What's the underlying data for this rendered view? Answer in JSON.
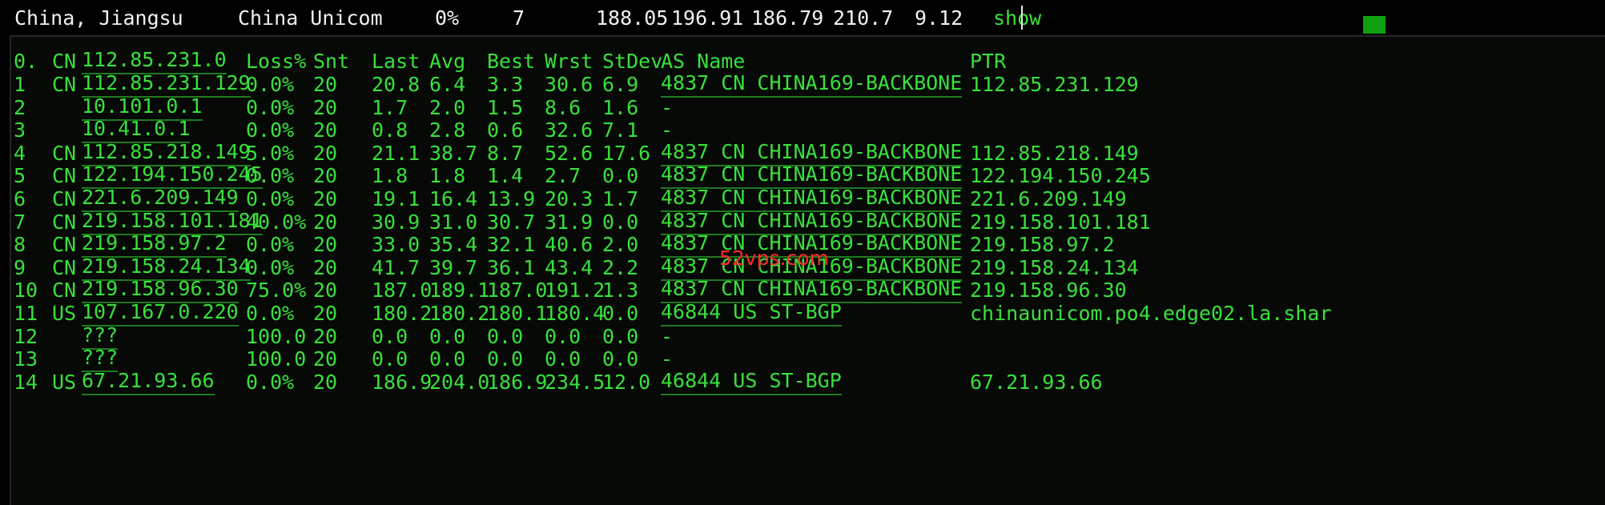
{
  "summary": {
    "location": "China, Jiangsu",
    "isp": "China Unicom",
    "loss": "0%",
    "count": "7",
    "v1": "188.05",
    "v2": "196.91",
    "v3": "186.79",
    "v4": "210.7",
    "v5": "9.12",
    "show_label": "show"
  },
  "table": {
    "header": {
      "hop": "0.",
      "cc": "CN",
      "host": "112.85.231.0",
      "loss": "Loss%",
      "snt": "Snt",
      "last": "Last",
      "avg": "Avg",
      "best": "Best",
      "wrst": "Wrst",
      "stdev": "StDev",
      "as": "AS Name",
      "ptr": "PTR"
    },
    "rows": [
      {
        "hop": "1",
        "cc": "CN",
        "host": "112.85.231.129",
        "loss": "0.0%",
        "snt": "20",
        "last": "20.8",
        "avg": "6.4",
        "best": "3.3",
        "wrst": "30.6",
        "stdev": "6.9",
        "as": "4837  CN CHINA169-BACKBONE",
        "ptr": "112.85.231.129"
      },
      {
        "hop": "2",
        "cc": "",
        "host": "10.101.0.1",
        "loss": "0.0%",
        "snt": "20",
        "last": "1.7",
        "avg": "2.0",
        "best": "1.5",
        "wrst": "8.6",
        "stdev": "1.6",
        "as": "-",
        "ptr": ""
      },
      {
        "hop": "3",
        "cc": "",
        "host": "10.41.0.1",
        "loss": "0.0%",
        "snt": "20",
        "last": "0.8",
        "avg": "2.8",
        "best": "0.6",
        "wrst": "32.6",
        "stdev": "7.1",
        "as": "-",
        "ptr": ""
      },
      {
        "hop": "4",
        "cc": "CN",
        "host": "112.85.218.149",
        "loss": "5.0%",
        "snt": "20",
        "last": "21.1",
        "avg": "38.7",
        "best": "8.7",
        "wrst": "52.6",
        "stdev": "17.6",
        "as": "4837  CN CHINA169-BACKBONE",
        "ptr": "112.85.218.149"
      },
      {
        "hop": "5",
        "cc": "CN",
        "host": "122.194.150.245",
        "loss": "0.0%",
        "snt": "20",
        "last": "1.8",
        "avg": "1.8",
        "best": "1.4",
        "wrst": "2.7",
        "stdev": "0.0",
        "as": "4837  CN CHINA169-BACKBONE",
        "ptr": "122.194.150.245"
      },
      {
        "hop": "6",
        "cc": "CN",
        "host": "221.6.209.149",
        "loss": "0.0%",
        "snt": "20",
        "last": "19.1",
        "avg": "16.4",
        "best": "13.9",
        "wrst": "20.3",
        "stdev": "1.7",
        "as": "4837  CN CHINA169-BACKBONE",
        "ptr": "221.6.209.149"
      },
      {
        "hop": "7",
        "cc": "CN",
        "host": "219.158.101.181",
        "loss": "40.0%",
        "snt": "20",
        "last": "30.9",
        "avg": "31.0",
        "best": "30.7",
        "wrst": "31.9",
        "stdev": "0.0",
        "as": "4837  CN CHINA169-BACKBONE",
        "ptr": "219.158.101.181"
      },
      {
        "hop": "8",
        "cc": "CN",
        "host": "219.158.97.2",
        "loss": "0.0%",
        "snt": "20",
        "last": "33.0",
        "avg": "35.4",
        "best": "32.1",
        "wrst": "40.6",
        "stdev": "2.0",
        "as": "4837  CN CHINA169-BACKBONE",
        "ptr": "219.158.97.2"
      },
      {
        "hop": "9",
        "cc": "CN",
        "host": "219.158.24.134",
        "loss": "0.0%",
        "snt": "20",
        "last": "41.7",
        "avg": "39.7",
        "best": "36.1",
        "wrst": "43.4",
        "stdev": "2.2",
        "as": "4837  CN CHINA169-BACKBONE",
        "ptr": "219.158.24.134"
      },
      {
        "hop": "10",
        "cc": "CN",
        "host": "219.158.96.30",
        "loss": "75.0%",
        "snt": "20",
        "last": "187.0",
        "avg": "189.1",
        "best": "187.0",
        "wrst": "191.2",
        "stdev": "1.3",
        "as": "4837  CN CHINA169-BACKBONE",
        "ptr": "219.158.96.30"
      },
      {
        "hop": "11",
        "cc": "US",
        "host": "107.167.0.220",
        "loss": "0.0%",
        "snt": "20",
        "last": "180.2",
        "avg": "180.2",
        "best": "180.1",
        "wrst": "180.4",
        "stdev": "0.0",
        "as": "46844 US ST-BGP",
        "ptr": "chinaunicom.po4.edge02.la.shar"
      },
      {
        "hop": "12",
        "cc": "",
        "host": "???",
        "loss": "100.0",
        "snt": "20",
        "last": "0.0",
        "avg": "0.0",
        "best": "0.0",
        "wrst": "0.0",
        "stdev": "0.0",
        "as": "-",
        "ptr": ""
      },
      {
        "hop": "13",
        "cc": "",
        "host": "???",
        "loss": "100.0",
        "snt": "20",
        "last": "0.0",
        "avg": "0.0",
        "best": "0.0",
        "wrst": "0.0",
        "stdev": "0.0",
        "as": "-",
        "ptr": ""
      },
      {
        "hop": "14",
        "cc": "US",
        "host": "67.21.93.66",
        "loss": "0.0%",
        "snt": "20",
        "last": "186.9",
        "avg": "204.0",
        "best": "186.9",
        "wrst": "234.5",
        "stdev": "12.0",
        "as": "46844 US ST-BGP",
        "ptr": "67.21.93.66"
      }
    ]
  },
  "watermark": "52vps.com",
  "colors": {
    "terminal_green": "#39e03c",
    "background": "#000000",
    "watermark_red": "#ff2b2b"
  }
}
